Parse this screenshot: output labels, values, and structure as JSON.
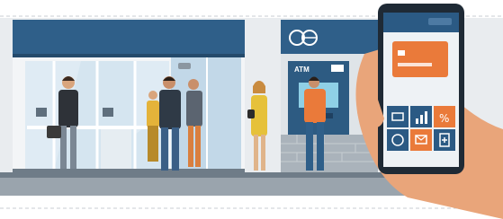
{
  "atm": {
    "sign_label": "ATM"
  },
  "phone": {
    "app_tiles": [
      {
        "icon": "card-icon",
        "color": "#2b5a84"
      },
      {
        "icon": "bar-chart-icon",
        "color": "#2b5a84"
      },
      {
        "icon": "percent-icon",
        "color": "#ea7a3a"
      },
      {
        "icon": "currency-exchange-icon",
        "color": "#2b5a84"
      },
      {
        "icon": "mail-icon",
        "color": "#ea7a3a"
      },
      {
        "icon": "document-add-icon",
        "color": "#2b5a84"
      }
    ]
  },
  "colors": {
    "brand_blue": "#2f5f89",
    "accent_orange": "#ea7a3a",
    "wall_gray": "#e9ecef",
    "sidewalk": "#9aa4ad"
  }
}
